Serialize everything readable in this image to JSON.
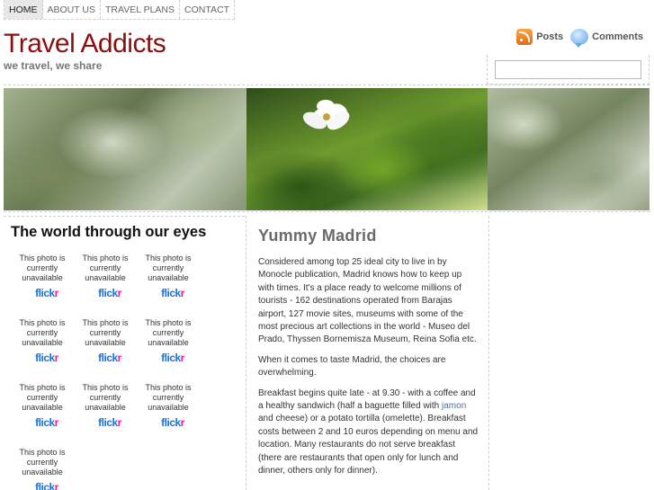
{
  "nav": {
    "items": [
      {
        "label": "HOME"
      },
      {
        "label": "ABOUT US"
      },
      {
        "label": "TRAVEL PLANS"
      },
      {
        "label": "CONTACT"
      }
    ]
  },
  "header": {
    "title": "Travel Addicts",
    "tagline": "we travel, we share",
    "posts_feed_label": "Posts",
    "comments_feed_label": "Comments"
  },
  "search": {
    "value": ""
  },
  "colors": {
    "title": "#8a0f0f",
    "nav_active_bg": "#e8e8e8",
    "flickr_blue": "#1a73d8",
    "flickr_pink": "#ff1981"
  },
  "sidebar": {
    "title": "The world through our eyes",
    "photos": [
      {
        "message": "This photo is currently unavailable",
        "logo_a": "flick",
        "logo_b": "r"
      },
      {
        "message": "This photo is currently unavailable",
        "logo_a": "flick",
        "logo_b": "r"
      },
      {
        "message": "This photo is currently unavailable",
        "logo_a": "flick",
        "logo_b": "r"
      },
      {
        "message": "This photo is currently unavailable",
        "logo_a": "flick",
        "logo_b": "r"
      },
      {
        "message": "This photo is currently unavailable",
        "logo_a": "flick",
        "logo_b": "r"
      },
      {
        "message": "This photo is currently unavailable",
        "logo_a": "flick",
        "logo_b": "r"
      },
      {
        "message": "This photo is currently unavailable",
        "logo_a": "flick",
        "logo_b": "r"
      },
      {
        "message": "This photo is currently unavailable",
        "logo_a": "flick",
        "logo_b": "r"
      },
      {
        "message": "This photo is currently unavailable",
        "logo_a": "flick",
        "logo_b": "r"
      },
      {
        "message": "This photo is currently unavailable",
        "logo_a": "flick",
        "logo_b": "r"
      }
    ]
  },
  "post": {
    "title": "Yummy Madrid",
    "p1": "Considered among top 25 ideal city to live in by Monocle publication, Madrid knows how to keep up with times. It's a place ready to welcome millions of tourists - 162 destinations operated from Barajas airport, 127 movie sites, museums with some of the most precious art collections in the world - Museo del Prado, Thyssen Bornemisza Museum, Reina Sofia etc.",
    "p2": "When it comes to taste Madrid, the choices are overwhelming.",
    "p3_a": "Breakfast begins quite late - at 9.30 - with a coffee and a healthy sandwich (half a baguette filled with ",
    "p3_link": "jamon",
    "p3_b": " and cheese) or a potato tortilla (omelette). Breakfast costs between 2 and 10 euros depending on menu and location. Many restaurants do not serve breakfast (there are restaurants that open only for lunch and dinner, others only for dinner)."
  }
}
